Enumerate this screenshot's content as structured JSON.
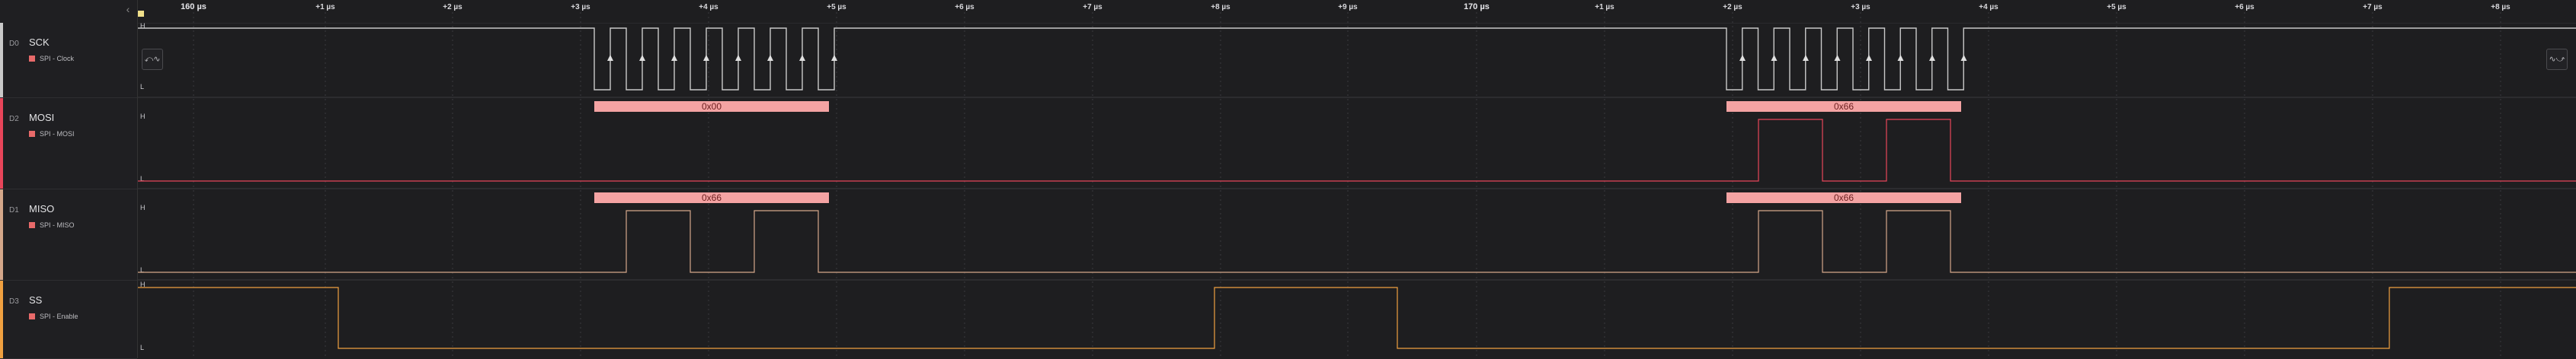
{
  "timeline": {
    "ticks": [
      {
        "label": "160 µs",
        "major": true
      },
      {
        "label": "+1 µs"
      },
      {
        "label": "+2 µs"
      },
      {
        "label": "+3 µs"
      },
      {
        "label": "+4 µs"
      },
      {
        "label": "+5 µs"
      },
      {
        "label": "+6 µs"
      },
      {
        "label": "+7 µs"
      },
      {
        "label": "+8 µs"
      },
      {
        "label": "+9 µs"
      },
      {
        "label": "170 µs",
        "major": true
      },
      {
        "label": "+1 µs"
      },
      {
        "label": "+2 µs"
      },
      {
        "label": "+3 µs"
      },
      {
        "label": "+4 µs"
      },
      {
        "label": "+5 µs"
      },
      {
        "label": "+6 µs"
      },
      {
        "label": "+7 µs"
      },
      {
        "label": "+8 µs"
      }
    ]
  },
  "channels": [
    {
      "id": "D0",
      "name": "SCK",
      "analyzer": "SPI - Clock",
      "color": "#c9c9c9",
      "signal": "clock"
    },
    {
      "id": "D2",
      "name": "MOSI",
      "analyzer": "SPI - MOSI",
      "color": "#e8455a",
      "signal": "mosi"
    },
    {
      "id": "D1",
      "name": "MISO",
      "analyzer": "SPI - MISO",
      "color": "#d4a78a",
      "signal": "miso"
    },
    {
      "id": "D3",
      "name": "SS",
      "analyzer": "SPI - Enable",
      "color": "#f0a040",
      "signal": "ss"
    }
  ],
  "levels": {
    "high": "H",
    "low": "L"
  },
  "decoded": {
    "mosi": [
      "0x00",
      "0x66"
    ],
    "miso": [
      "0x66",
      "0x66"
    ]
  },
  "nav": {
    "prev": "⤺∿",
    "next": "∿⤻"
  },
  "colors": {
    "bubble": "#f4a3a3",
    "clock_wave": "#c9c9c9",
    "mosi_wave": "#e8455a",
    "miso_wave": "#d4a78a",
    "ss_wave": "#f0a040"
  }
}
